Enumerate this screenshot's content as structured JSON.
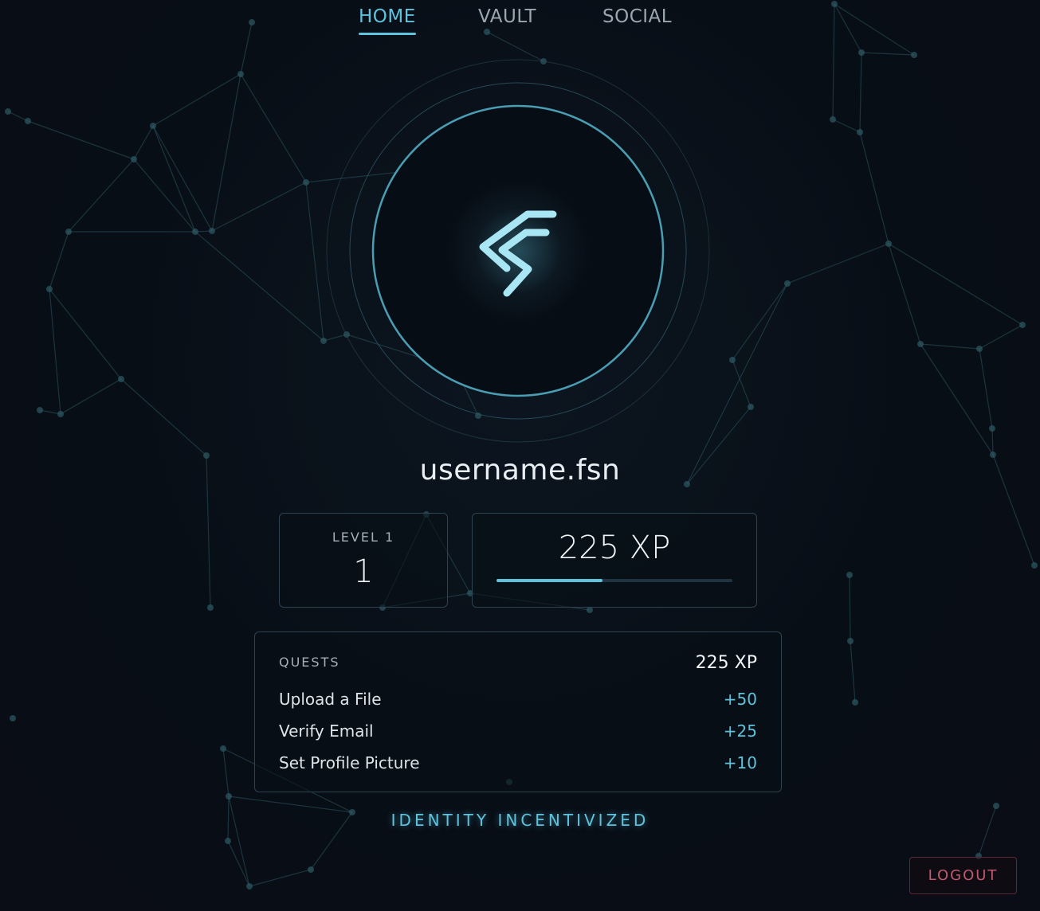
{
  "nav": {
    "tabs": [
      {
        "label": "HOME",
        "active": true
      },
      {
        "label": "VAULT",
        "active": false
      },
      {
        "label": "SOCIAL",
        "active": false
      }
    ]
  },
  "profile": {
    "emblem_icon": "fsn-lightning-logo-icon",
    "username": "username.fsn"
  },
  "level": {
    "label": "LEVEL 1",
    "value": "1"
  },
  "xp": {
    "value": "225 XP",
    "progress_fraction": 0.45
  },
  "quests": {
    "title": "QUESTS",
    "total": "225 XP",
    "items": [
      {
        "name": "Upload a File",
        "reward": "+50"
      },
      {
        "name": "Verify Email",
        "reward": "+25"
      },
      {
        "name": "Set Profile Picture",
        "reward": "+10"
      }
    ]
  },
  "tagline": "IDENTITY INCENTIVIZED",
  "logout_label": "LOGOUT",
  "colors": {
    "accent": "#5ec3dc",
    "background": "#080e16",
    "logout": "#c05a6e"
  }
}
